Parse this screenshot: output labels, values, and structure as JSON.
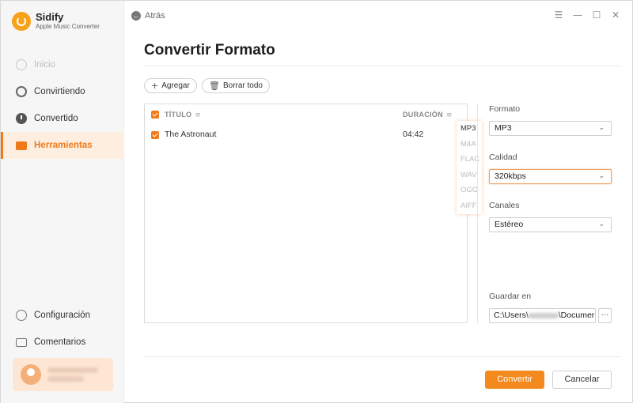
{
  "app": {
    "name": "Sidify",
    "subtitle": "Apple Music Converter"
  },
  "sidebar": {
    "items": [
      {
        "label": "Inicio",
        "icon": "home-icon"
      },
      {
        "label": "Convirtiendo",
        "icon": "sync-icon"
      },
      {
        "label": "Convertido",
        "icon": "clock-icon"
      },
      {
        "label": "Herramientas",
        "icon": "toolbox-icon"
      }
    ],
    "bottom": [
      {
        "label": "Configuración",
        "icon": "gear-icon"
      },
      {
        "label": "Comentarios",
        "icon": "mail-icon"
      }
    ]
  },
  "titlebar": {
    "back_label": "Atrás",
    "menu": "☰",
    "minimize": "—",
    "maximize": "☐",
    "close": "✕"
  },
  "main": {
    "title": "Convertir Formato",
    "add_label": "Agregar",
    "clear_label": "Borrar todo",
    "table": {
      "col_title": "TÍTULO",
      "col_duration": "DURACIÓN",
      "rows": [
        {
          "title": "The Astronaut",
          "duration": "04:42"
        }
      ]
    },
    "format_options": [
      "MP3",
      "M4A",
      "FLAC",
      "WAV",
      "OGG",
      "AIFF"
    ]
  },
  "settings": {
    "format_label": "Formato",
    "format_value": "MP3",
    "quality_label": "Calidad",
    "quality_value": "320kbps",
    "channels_label": "Canales",
    "channels_value": "Estéreo",
    "save_label": "Guardar en",
    "path_prefix": "C:\\Users\\",
    "path_suffix": "\\Documer",
    "browse_label": "···"
  },
  "actions": {
    "convert_label": "Convertir",
    "cancel_label": "Cancelar"
  },
  "colors": {
    "accent": "#f48a1e",
    "accent_bg": "#fdeee0"
  }
}
